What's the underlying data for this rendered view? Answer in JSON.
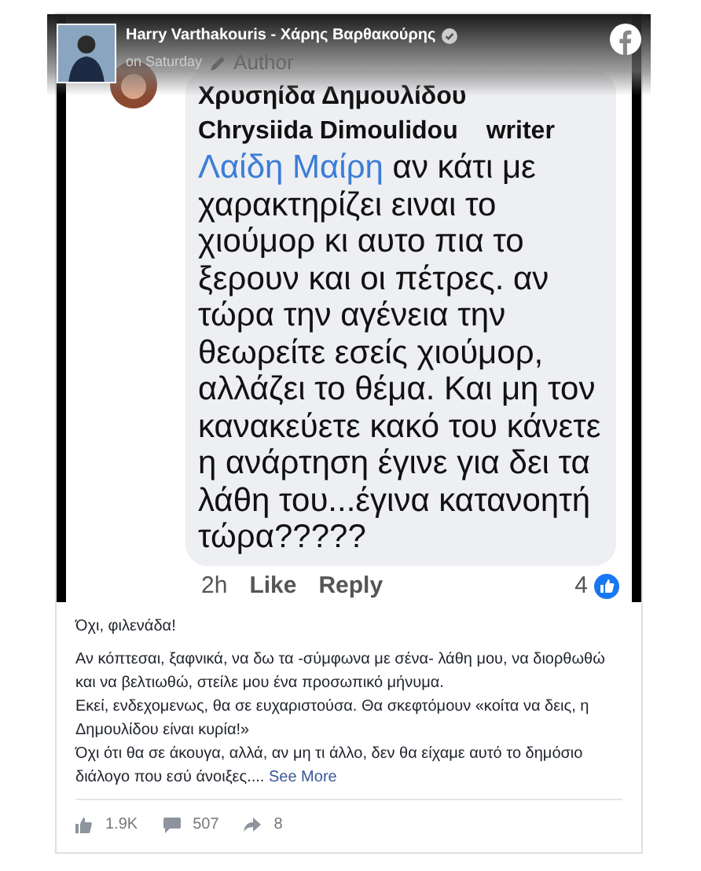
{
  "post_header": {
    "author": "Harry Varthakouris - Χάρης Βαρθακούρης",
    "verified": true,
    "time": "on Saturday",
    "role": "Author"
  },
  "screenshot_comment": {
    "name": "Χρυσηίδα Δημουλίδου",
    "name_latin": "Chrysiida Dimoulidou",
    "badge": "writer",
    "mention": "Λαίδη Μαίρη",
    "text": " αν κάτι με χαρακτηρίζει ειναι το χιούμορ κι αυτο πια το ξερουν και οι πέτρες. αν τώρα την αγένεια την θεωρείτε εσείς χιούμορ, αλλάζει το θέμα. Και μη τον κανακεύετε κακό του κάνετε η ανάρτηση έγινε για δει τα λάθη του...έγινα κατανοητή τώρα?????",
    "time": "2h",
    "actions": [
      "Like",
      "Reply"
    ],
    "reactions": "4"
  },
  "post_body": {
    "paragraphs": [
      "Όχι, φιλενάδα!",
      "Αν κόπτεσαι, ξαφνικά, να δω τα -σύμφωνα με σένα- λάθη μου, να διορθωθώ και να βελτιωθώ, στείλε μου ένα προσωπικό μήνυμα.\nΕκεί, ενδεχομενως, θα σε ευχαριστούσα. Θα σκεφτόμουν «κοίτα να δεις, η Δημουλίδου είναι κυρία!»\nΌχι ότι θα σε άκουγα, αλλά, αν μη τι άλλο, δεν θα είχαμε αυτό το δημόσιο διάλογο που εσύ άνοιξες...."
    ],
    "see_more": "See More"
  },
  "stats": {
    "likes": "1.9K",
    "comments": "507",
    "shares": "8"
  }
}
